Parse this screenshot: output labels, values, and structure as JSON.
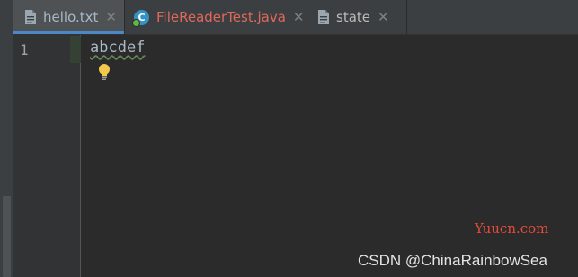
{
  "tabs": [
    {
      "label": "hello.txt",
      "icon": "text-file-icon",
      "color": "#a9b7c6",
      "active": true
    },
    {
      "label": "FileReaderTest.java",
      "icon": "java-class-icon",
      "color": "#e0685a",
      "active": false
    },
    {
      "label": "state",
      "icon": "text-file-icon",
      "color": "#bbbbbb",
      "active": false
    }
  ],
  "close_glyph": "✕",
  "java_icon_letter": "C",
  "editor": {
    "line_number": "1",
    "code": "abcdef"
  },
  "watermark": "Yuucn.com",
  "credit": "CSDN @ChinaRainbowSea",
  "colors": {
    "background": "#2b2b2b",
    "tab_accent": "#4a88c7",
    "watermark": "#e64a3b"
  }
}
